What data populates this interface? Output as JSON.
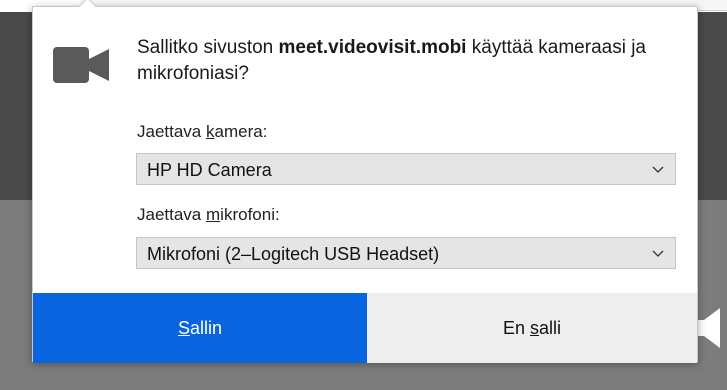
{
  "prompt": {
    "message_prefix": "Sallitko sivuston ",
    "site": "meet.videovisit.mobi",
    "message_suffix": " käyttää kameraasi ja mikrofoniasi?"
  },
  "camera": {
    "label_before": "Jaettava ",
    "label_access_key": "k",
    "label_after": "amera:",
    "selected": "HP HD Camera"
  },
  "microphone": {
    "label_before": "Jaettava ",
    "label_access_key": "m",
    "label_after": "ikrofoni:",
    "selected": "Mikrofoni (2–Logitech USB Headset)"
  },
  "buttons": {
    "allow_access_key": "S",
    "allow_rest": "allin",
    "deny_before": "En ",
    "deny_access_key": "s",
    "deny_rest": "alli"
  },
  "colors": {
    "allow_bg": "#0a64e0",
    "deny_bg": "#eeeeee",
    "icon": "#5a5a5a"
  },
  "icons": {
    "camera": "video-camera-icon",
    "dropdown": "chevron-down-icon",
    "background": "speaker-icon"
  }
}
